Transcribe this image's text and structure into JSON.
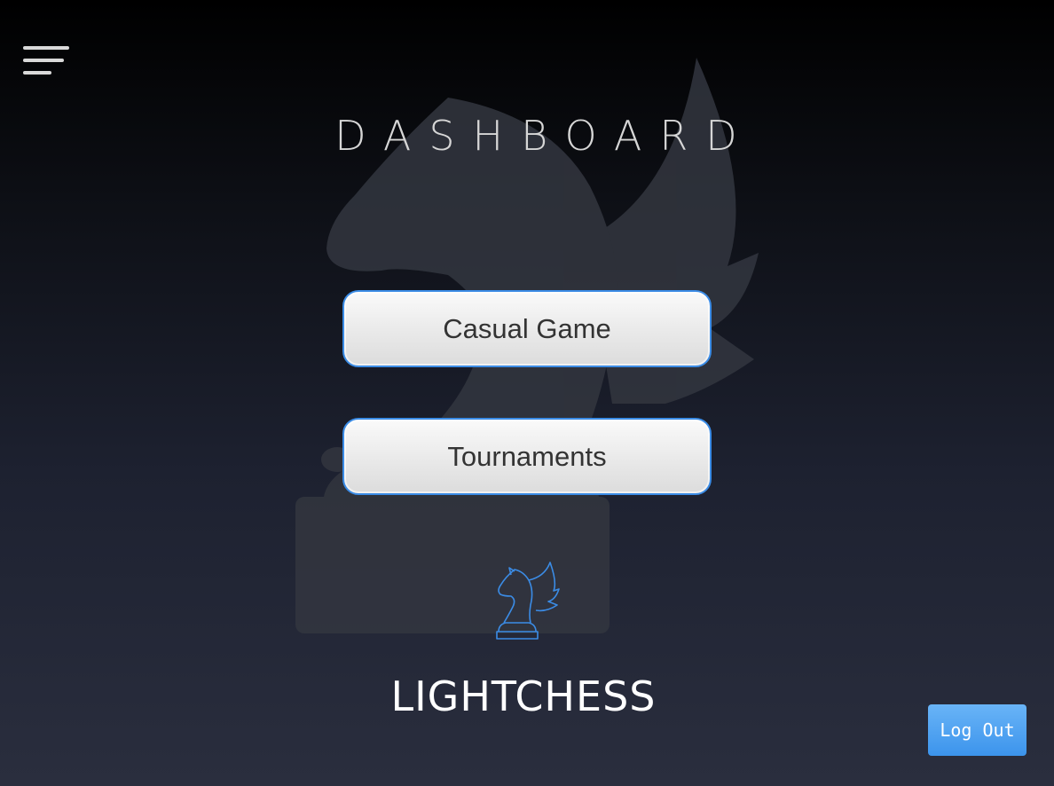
{
  "header": {
    "menu_icon": "hamburger-menu-icon",
    "title": "DASHBOARD"
  },
  "main": {
    "buttons": [
      {
        "label": "Casual Game"
      },
      {
        "label": "Tournaments"
      }
    ]
  },
  "brand": {
    "logo_icon": "winged-knight-icon",
    "name": "LIGHTCHESS"
  },
  "footer": {
    "logout_label": "Log Out"
  },
  "colors": {
    "accent": "#3b8ce6",
    "background_top": "#000000",
    "background_bottom": "#2a2e3e",
    "watermark": "#353945",
    "logout_bg": "#4a9ff0"
  }
}
